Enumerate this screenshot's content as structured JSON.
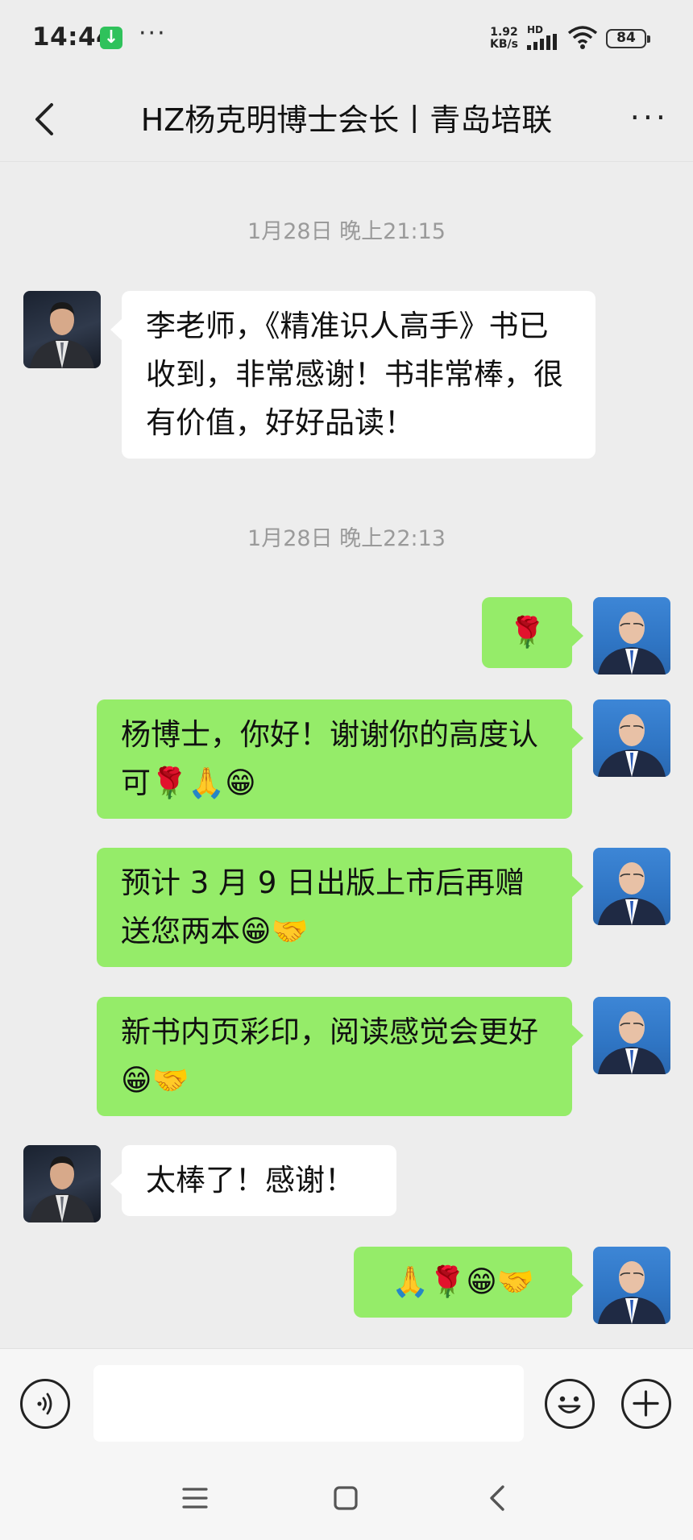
{
  "status_bar": {
    "time": "14:44",
    "net_speed_value": "1.92",
    "net_speed_unit": "KB/s",
    "hd_label": "HD",
    "battery": "84",
    "icons": [
      "download-notification-icon",
      "more-dots-icon",
      "signal-icon",
      "wifi-icon",
      "battery-icon"
    ]
  },
  "header": {
    "title": "HZ杨克明博士会长丨青岛培联",
    "back_icon": "chevron-left-icon",
    "more_icon": "more-dots-icon"
  },
  "conversation": {
    "timestamps": [
      "1月28日 晚上21:15",
      "1月28日 晚上22:13"
    ],
    "messages": [
      {
        "side": "in",
        "text": "李老师，《精准识人高手》书已收到，非常感谢！书非常棒，很有价值，好好品读！"
      },
      {
        "side": "out",
        "text": "🌹"
      },
      {
        "side": "out",
        "text": "杨博士，你好！谢谢你的高度认可🌹🙏😁"
      },
      {
        "side": "out",
        "text": "预计 3 月 9 日出版上市后再赠送您两本😁🤝"
      },
      {
        "side": "out",
        "text": "新书内页彩印，阅读感觉会更好😁🤝"
      },
      {
        "side": "in",
        "text": "太棒了！感谢！"
      },
      {
        "side": "out",
        "text": "🙏🌹😁🤝"
      }
    ]
  },
  "input_bar": {
    "voice_icon": "voice-icon",
    "emoji_icon": "emoji-icon",
    "plus_icon": "plus-icon",
    "input_value": ""
  },
  "nav_bar": {
    "icons": [
      "menu-icon",
      "home-icon",
      "back-icon"
    ]
  },
  "colors": {
    "background": "#ededed",
    "incoming_bubble": "#ffffff",
    "outgoing_bubble": "#95ec69",
    "timestamp_text": "#9a9a9a"
  }
}
